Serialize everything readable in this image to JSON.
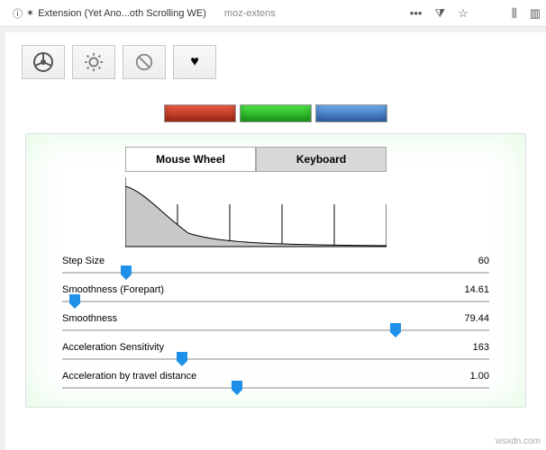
{
  "browser": {
    "tab_title": "Extension (Yet Ano...oth Scrolling WE)",
    "url_hint": "moz-extens",
    "dots": "•••"
  },
  "iconbar": {
    "wheel": "steering-wheel",
    "gear": "gear",
    "none": "prohibited",
    "heart": "heart"
  },
  "colors": {
    "red": "#cc3a20",
    "green": "#2bc828",
    "blue": "#4a84d6"
  },
  "tabs": {
    "mouse_wheel": "Mouse Wheel",
    "keyboard": "Keyboard"
  },
  "chart_data": {
    "type": "area",
    "title": "",
    "xlabel": "",
    "ylabel": "",
    "x": [
      0,
      1,
      2,
      3,
      4,
      5,
      6,
      7,
      8,
      9,
      10,
      11,
      12,
      13,
      14,
      15,
      16,
      17,
      18,
      19,
      20
    ],
    "values": [
      50,
      42,
      34,
      27,
      20,
      14,
      10,
      7,
      5,
      4,
      3,
      2,
      2,
      1.5,
      1.2,
      1,
      0.8,
      0.6,
      0.5,
      0.4,
      0.3
    ],
    "ylim": [
      0,
      55
    ],
    "xlim": [
      0,
      20
    ],
    "gridticks_x": [
      0,
      4,
      8,
      12,
      16,
      20
    ]
  },
  "sliders": [
    {
      "label": "Step Size",
      "value": "60",
      "pos": 0.15
    },
    {
      "label": "Smoothness (Forepart)",
      "value": "14.61",
      "pos": 0.03
    },
    {
      "label": "Smoothness",
      "value": "79.44",
      "pos": 0.78
    },
    {
      "label": "Acceleration Sensitivity",
      "value": "163",
      "pos": 0.28
    },
    {
      "label": "Acceleration by travel distance",
      "value": "1.00",
      "pos": 0.41
    }
  ],
  "watermark": "wsxdn.com"
}
